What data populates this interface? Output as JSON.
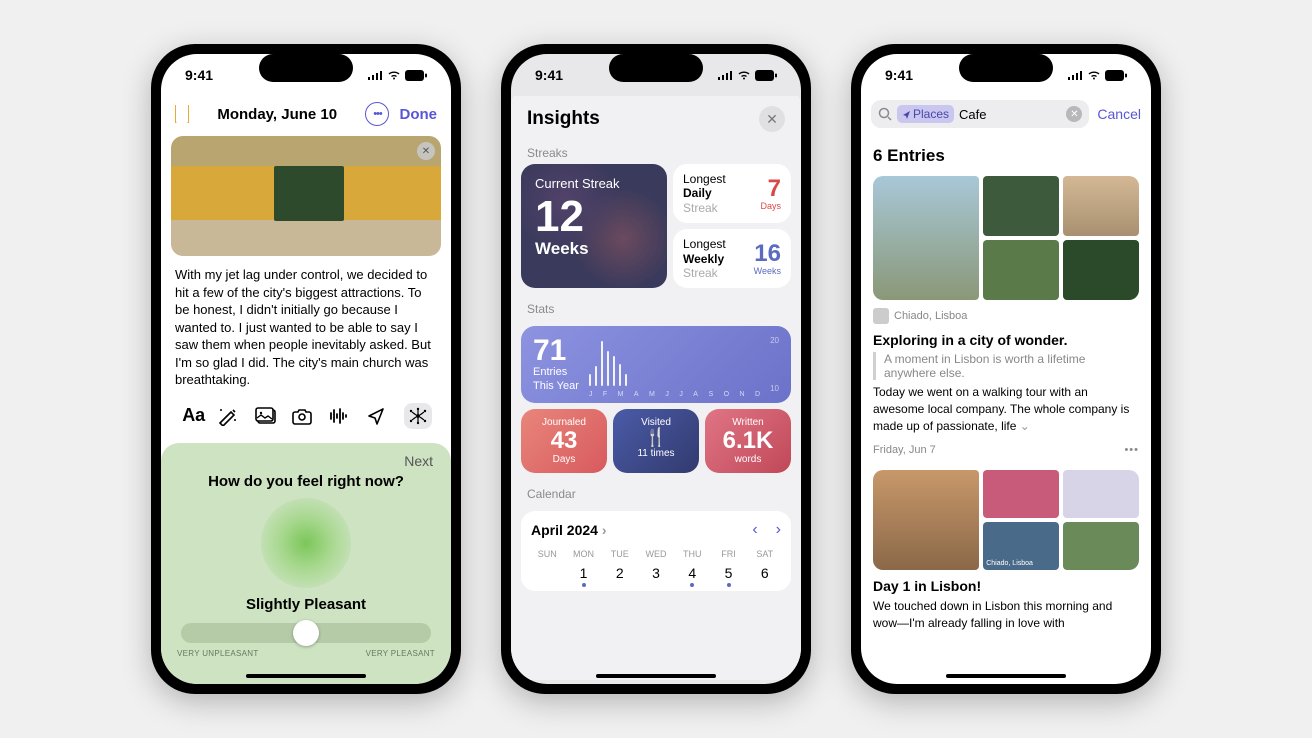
{
  "status": {
    "time": "9:41"
  },
  "phone1": {
    "nav": {
      "date": "Monday, June 10",
      "done": "Done"
    },
    "entry_text": "With my jet lag under control, we decided to hit a few of the city's biggest attractions. To be honest, I didn't initially go because I wanted to. I just wanted to be able to say I saw them when people inevitably asked. But I'm so glad I did. The city's main church was breathtaking.",
    "mood": {
      "next": "Next",
      "question": "How do you feel right now?",
      "label": "Slightly Pleasant",
      "min": "VERY UNPLEASANT",
      "max": "VERY PLEASANT",
      "slider_pct": 50
    }
  },
  "phone2": {
    "title": "Insights",
    "sections": {
      "streaks": "Streaks",
      "stats": "Stats",
      "calendar": "Calendar"
    },
    "streak_current": {
      "label": "Current Streak",
      "value": "12",
      "unit": "Weeks"
    },
    "streak_daily": {
      "l1": "Longest",
      "l2": "Daily",
      "l3": "Streak",
      "value": "7",
      "unit": "Days"
    },
    "streak_weekly": {
      "l1": "Longest",
      "l2": "Weekly",
      "l3": "Streak",
      "value": "16",
      "unit": "Weeks"
    },
    "stats_main": {
      "value": "71",
      "l1": "Entries",
      "l2": "This Year"
    },
    "journaled": {
      "t": "Journaled",
      "n": "43",
      "u": "Days"
    },
    "visited": {
      "t": "Visited",
      "icon": "🍴",
      "n": "11 times"
    },
    "written": {
      "t": "Written",
      "n": "6.1K",
      "u": "words"
    },
    "calendar": {
      "month": "April 2024",
      "dow": [
        "SUN",
        "MON",
        "TUE",
        "WED",
        "THU",
        "FRI",
        "SAT"
      ],
      "days": [
        "",
        "1",
        "2",
        "3",
        "4",
        "5",
        "6"
      ],
      "dots": [
        false,
        true,
        false,
        false,
        true,
        true,
        false
      ]
    }
  },
  "phone3": {
    "search": {
      "token": "Places",
      "query": "Cafe",
      "cancel": "Cancel"
    },
    "count": "6 Entries",
    "entry1": {
      "location": "Chiado, Lisboa",
      "title": "Exploring in a city of wonder.",
      "quote": "A moment in Lisbon is worth a lifetime anywhere else.",
      "body": "Today we went on a walking tour with an awesome local company. The whole company is made up of passionate, life",
      "date": "Friday, Jun 7"
    },
    "entry2": {
      "map_label": "Chiado, Lisboa",
      "title": "Day 1 in Lisbon!",
      "body": "We touched down in Lisbon this morning and wow—I'm already falling in love with"
    }
  },
  "chart_data": {
    "type": "bar",
    "title": "Entries This Year",
    "categories": [
      "J",
      "F",
      "M",
      "A",
      "M",
      "J",
      "J",
      "A",
      "S",
      "O",
      "N",
      "D"
    ],
    "values": [
      5,
      8,
      18,
      14,
      12,
      9,
      5,
      0,
      0,
      0,
      0,
      0
    ],
    "ylim": [
      0,
      20
    ],
    "yticks": [
      10,
      20
    ],
    "total": 71
  }
}
